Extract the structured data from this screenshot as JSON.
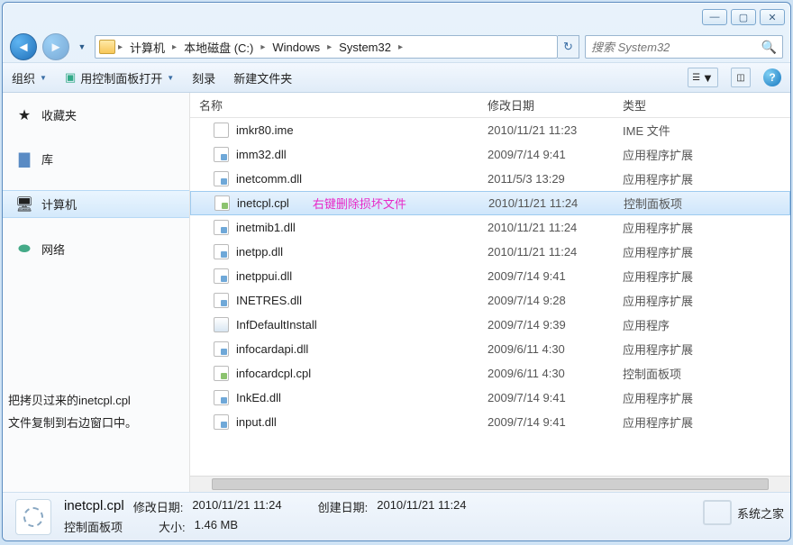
{
  "breadcrumb": [
    "计算机",
    "本地磁盘 (C:)",
    "Windows",
    "System32"
  ],
  "search": {
    "placeholder": "搜索 System32"
  },
  "toolbar": {
    "organize": "组织",
    "open_cpl": "用控制面板打开",
    "burn": "刻录",
    "newfolder": "新建文件夹"
  },
  "sidebar": {
    "fav": "收藏夹",
    "lib": "库",
    "computer": "计算机",
    "network": "网络"
  },
  "annot_left_l1": "把拷贝过来的inetcpl.cpl",
  "annot_left_l2": "文件复制到右边窗口中。",
  "columns": {
    "name": "名称",
    "date": "修改日期",
    "type": "类型"
  },
  "row_annot": "右键删除损坏文件",
  "files": [
    {
      "n": "imkr80.ime",
      "d": "2010/11/21 11:23",
      "t": "IME 文件",
      "k": "ime"
    },
    {
      "n": "imm32.dll",
      "d": "2009/7/14 9:41",
      "t": "应用程序扩展",
      "k": "dll"
    },
    {
      "n": "inetcomm.dll",
      "d": "2011/5/3 13:29",
      "t": "应用程序扩展",
      "k": "dll"
    },
    {
      "n": "inetcpl.cpl",
      "d": "2010/11/21 11:24",
      "t": "控制面板项",
      "k": "cpl",
      "sel": true,
      "annot": true
    },
    {
      "n": "inetmib1.dll",
      "d": "2010/11/21 11:24",
      "t": "应用程序扩展",
      "k": "dll"
    },
    {
      "n": "inetpp.dll",
      "d": "2010/11/21 11:24",
      "t": "应用程序扩展",
      "k": "dll"
    },
    {
      "n": "inetppui.dll",
      "d": "2009/7/14 9:41",
      "t": "应用程序扩展",
      "k": "dll"
    },
    {
      "n": "INETRES.dll",
      "d": "2009/7/14 9:28",
      "t": "应用程序扩展",
      "k": "dll"
    },
    {
      "n": "InfDefaultInstall",
      "d": "2009/7/14 9:39",
      "t": "应用程序",
      "k": "exe"
    },
    {
      "n": "infocardapi.dll",
      "d": "2009/6/11 4:30",
      "t": "应用程序扩展",
      "k": "dll"
    },
    {
      "n": "infocardcpl.cpl",
      "d": "2009/6/11 4:30",
      "t": "控制面板项",
      "k": "cpl"
    },
    {
      "n": "InkEd.dll",
      "d": "2009/7/14 9:41",
      "t": "应用程序扩展",
      "k": "dll"
    },
    {
      "n": "input.dll",
      "d": "2009/7/14 9:41",
      "t": "应用程序扩展",
      "k": "dll"
    }
  ],
  "status": {
    "name": "inetcpl.cpl",
    "mdate_lbl": "修改日期:",
    "mdate": "2010/11/21 11:24",
    "cdate_lbl": "创建日期:",
    "cdate": "2010/11/21 11:24",
    "type": "控制面板项",
    "size_lbl": "大小:",
    "size": "1.46 MB"
  },
  "watermark": "系统之家"
}
